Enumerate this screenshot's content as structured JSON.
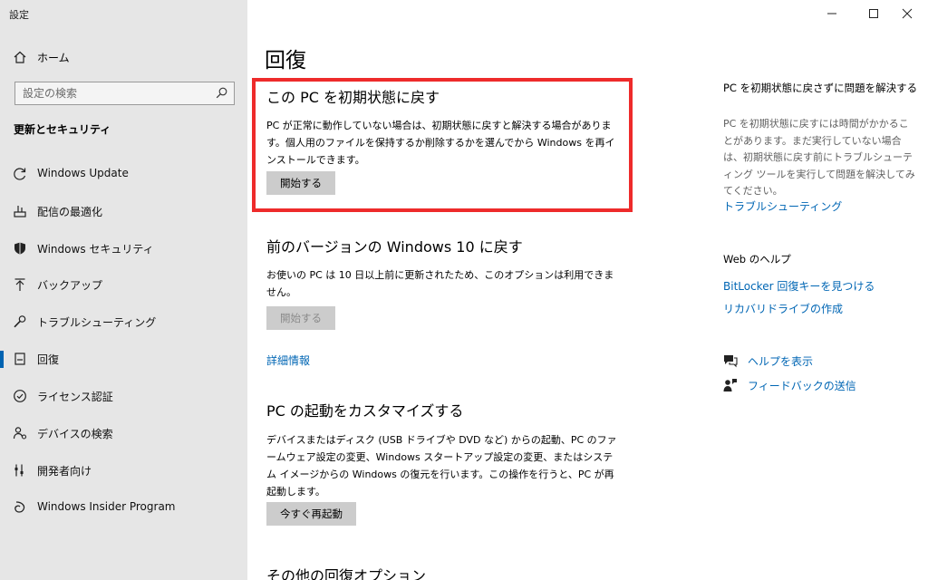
{
  "window": {
    "title": "設定"
  },
  "sidebar": {
    "home_label": "ホーム",
    "search_placeholder": "設定の検索",
    "section_title": "更新とセキュリティ",
    "items": [
      {
        "label": "Windows Update",
        "icon": "refresh-icon"
      },
      {
        "label": "配信の最適化",
        "icon": "delivery-optimization-icon"
      },
      {
        "label": "Windows セキュリティ",
        "icon": "shield-icon"
      },
      {
        "label": "バックアップ",
        "icon": "backup-arrow-icon"
      },
      {
        "label": "トラブルシューティング",
        "icon": "wrench-icon"
      },
      {
        "label": "回復",
        "icon": "recovery-icon",
        "active": true
      },
      {
        "label": "ライセンス認証",
        "icon": "check-circle-icon"
      },
      {
        "label": "デバイスの検索",
        "icon": "person-pin-icon"
      },
      {
        "label": "開発者向け",
        "icon": "developer-icon"
      },
      {
        "label": "Windows Insider Program",
        "icon": "insider-icon"
      }
    ]
  },
  "main": {
    "title": "回復",
    "reset": {
      "heading": "この PC を初期状態に戻す",
      "text": "PC が正常に動作していない場合は、初期状態に戻すと解決する場合があります。個人用のファイルを保持するか削除するかを選んでから Windows を再インストールできます。",
      "button": "開始する"
    },
    "goback": {
      "heading": "前のバージョンの Windows 10 に戻す",
      "text": "お使いの PC は 10 日以上前に更新されたため、このオプションは利用できません。",
      "button": "開始する",
      "link": "詳細情報"
    },
    "startup": {
      "heading": "PC の起動をカスタマイズする",
      "text": "デバイスまたはディスク (USB ドライブや DVD など) からの起動、PC のファームウェア設定の変更、Windows スタートアップ設定の変更、またはシステム イメージからの Windows の復元を行います。この操作を行うと、PC が再起動します。",
      "button": "今すぐ再起動"
    },
    "more": {
      "heading": "その他の回復オプション"
    }
  },
  "right": {
    "issue_heading": "PC を初期状態に戻さずに問題を解決する",
    "issue_text": "PC を初期状態に戻すには時間がかかることがあります。まだ実行していない場合は、初期状態に戻す前にトラブルシューティング ツールを実行して問題を解決してみてください。",
    "troubleshoot_link": "トラブルシューティング",
    "web_help_heading": "Web のヘルプ",
    "bitlocker_link": "BitLocker 回復キーを見つける",
    "recovery_drive_link": "リカバリドライブの作成",
    "help_link": "ヘルプを表示",
    "feedback_link": "フィードバックの送信"
  },
  "colors": {
    "accent": "#0063b1",
    "link": "#0066b4",
    "highlight": "#ee2b2b",
    "sidebar_bg": "#e6e6e6"
  }
}
